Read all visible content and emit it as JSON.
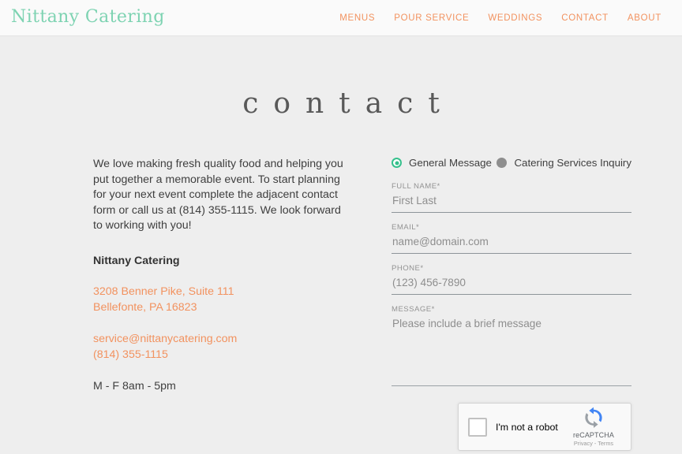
{
  "header": {
    "brand": "Nittany Catering",
    "nav": [
      {
        "label": "MENUS",
        "name": "nav-menus"
      },
      {
        "label": "POUR SERVICE",
        "name": "nav-pour-service"
      },
      {
        "label": "WEDDINGS",
        "name": "nav-weddings"
      },
      {
        "label": "CONTACT",
        "name": "nav-contact"
      },
      {
        "label": "ABOUT",
        "name": "nav-about"
      }
    ]
  },
  "page": {
    "title": "contact"
  },
  "left": {
    "intro": "We love making fresh quality food and helping you put together a memorable event. To start planning for your next event complete the adjacent contact form or call us at (814) 355-1115. We look forward to working with you!",
    "business_name": "Nittany Catering",
    "address_line1": "3208 Benner Pike, Suite 111",
    "address_line2": "Bellefonte, PA 16823",
    "email": "service@nittanycatering.com",
    "phone": "(814) 355-1115",
    "hours": "M - F 8am - 5pm"
  },
  "form": {
    "radios": [
      {
        "label": "General Message",
        "selected": true
      },
      {
        "label": "Catering Services Inquiry",
        "selected": false
      }
    ],
    "fields": [
      {
        "label": "FULL NAME*",
        "placeholder": "First Last",
        "value": ""
      },
      {
        "label": "EMAIL*",
        "placeholder": "name@domain.com",
        "value": ""
      },
      {
        "label": "PHONE*",
        "placeholder": "(123) 456-7890",
        "value": ""
      },
      {
        "label": "MESSAGE*",
        "placeholder": "Please include a brief message",
        "value": ""
      }
    ],
    "recaptcha": {
      "label": "I'm not a robot",
      "brand": "reCAPTCHA",
      "legal": "Privacy - Terms"
    }
  },
  "colors": {
    "brand_green": "#7ed3b2",
    "accent_orange": "#f2925f",
    "radio_selected_green": "#35c08c",
    "page_background": "#eeeeee",
    "header_background": "#fafafa",
    "field_rule": "#8d9499"
  }
}
